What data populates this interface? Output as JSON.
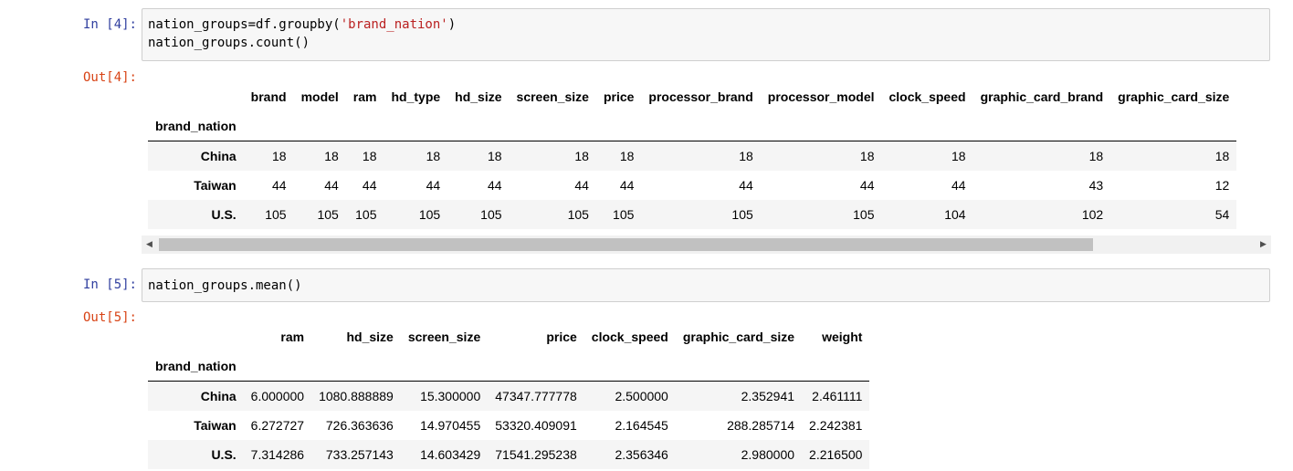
{
  "cells": [
    {
      "in_prompt": "In [4]:",
      "out_prompt": "Out[4]:",
      "code_line1_a": "nation_groups=df.groupby(",
      "code_line1_str": "'brand_nation'",
      "code_line1_b": ")",
      "code_line2": "nation_groups.count()",
      "table": {
        "index_name": "brand_nation",
        "columns": [
          "brand",
          "model",
          "ram",
          "hd_type",
          "hd_size",
          "screen_size",
          "price",
          "processor_brand",
          "processor_model",
          "clock_speed",
          "graphic_card_brand",
          "graphic_card_size"
        ],
        "rows": [
          {
            "index": "China",
            "values": [
              "18",
              "18",
              "18",
              "18",
              "18",
              "18",
              "18",
              "18",
              "18",
              "18",
              "18",
              "18"
            ]
          },
          {
            "index": "Taiwan",
            "values": [
              "44",
              "44",
              "44",
              "44",
              "44",
              "44",
              "44",
              "44",
              "44",
              "44",
              "43",
              "12"
            ]
          },
          {
            "index": "U.S.",
            "values": [
              "105",
              "105",
              "105",
              "105",
              "105",
              "105",
              "105",
              "105",
              "105",
              "104",
              "102",
              "54"
            ]
          }
        ]
      }
    },
    {
      "in_prompt": "In [5]:",
      "out_prompt": "Out[5]:",
      "code_line1": "nation_groups.mean()",
      "table": {
        "index_name": "brand_nation",
        "columns": [
          "ram",
          "hd_size",
          "screen_size",
          "price",
          "clock_speed",
          "graphic_card_size",
          "weight"
        ],
        "rows": [
          {
            "index": "China",
            "values": [
              "6.000000",
              "1080.888889",
              "15.300000",
              "47347.777778",
              "2.500000",
              "2.352941",
              "2.461111"
            ]
          },
          {
            "index": "Taiwan",
            "values": [
              "6.272727",
              "726.363636",
              "14.970455",
              "53320.409091",
              "2.164545",
              "288.285714",
              "2.242381"
            ]
          },
          {
            "index": "U.S.",
            "values": [
              "7.314286",
              "733.257143",
              "14.603429",
              "71541.295238",
              "2.356346",
              "2.980000",
              "2.216500"
            ]
          }
        ]
      }
    }
  ],
  "scrollbar": {
    "left_arrow_icon": "triangle-left-icon",
    "right_arrow_icon": "triangle-right-icon",
    "thumb_fraction_visible": 0.83,
    "thumb_offset_fraction": 0.0
  }
}
